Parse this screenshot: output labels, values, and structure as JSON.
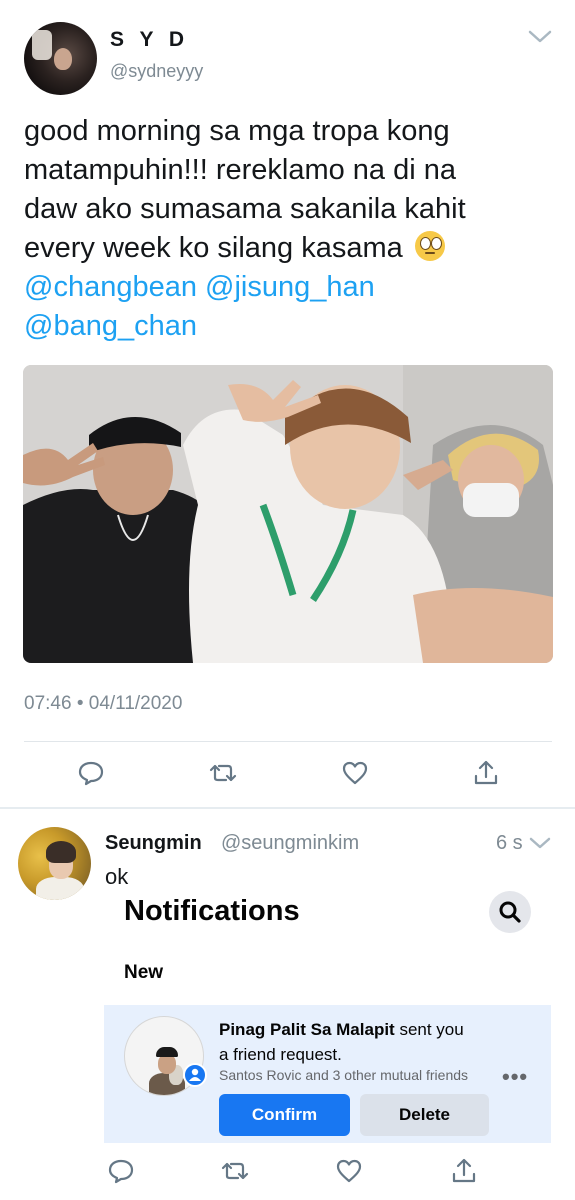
{
  "tweet": {
    "display_name": "S Y D",
    "handle": "@sydneyyy",
    "text_lines": [
      "good morning sa mga tropa kong",
      "matampuhin!!! rereklamo na di na",
      "daw ako sumasama sakanila kahit",
      "every week ko silang kasama"
    ],
    "emoji": "eye-roll-emoji",
    "mentions_line1": "@changbean @jisung_han",
    "mentions_line2": "@bang_chan",
    "photo_icon": "selfie-photo",
    "timestamp": "07:46 • 04/11/2020",
    "actions": [
      "reply-icon",
      "retweet-icon",
      "like-icon",
      "share-icon"
    ]
  },
  "reply": {
    "display_name": "Seungmin",
    "handle": "@seungminkim",
    "time": "6 s",
    "text": "ok",
    "actions": [
      "reply-icon",
      "retweet-icon",
      "like-icon",
      "share-icon"
    ]
  },
  "facebook": {
    "title": "Notifications",
    "section": "New",
    "requester": "Pinag Palit Sa Malapit",
    "message_suffix": " sent you",
    "message_line2": "a friend request.",
    "mutual": "Santos Rovic and 3 other mutual friends",
    "more": "•••",
    "confirm_label": "Confirm",
    "delete_label": "Delete"
  },
  "colors": {
    "link": "#1da1f2",
    "muted": "#7e8a93",
    "fb_blue": "#1877f2",
    "fb_card": "#e7f0fd"
  }
}
